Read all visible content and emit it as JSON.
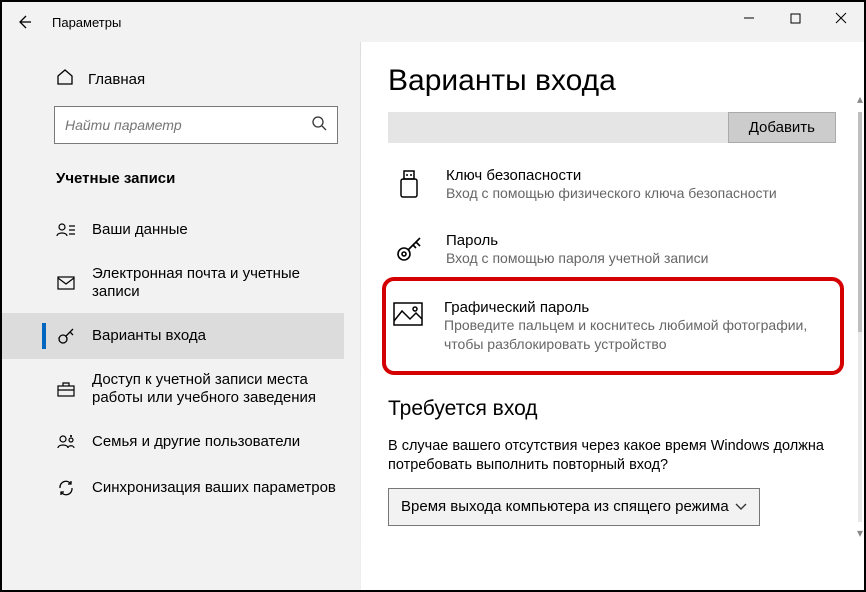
{
  "window": {
    "title": "Параметры"
  },
  "sidebar": {
    "home_label": "Главная",
    "search_placeholder": "Найти параметр",
    "section_title": "Учетные записи",
    "items": [
      {
        "label": "Ваши данные"
      },
      {
        "label": "Электронная почта и учетные записи"
      },
      {
        "label": "Варианты входа"
      },
      {
        "label": "Доступ к учетной записи места работы или учебного заведения"
      },
      {
        "label": "Семья и другие пользователи"
      },
      {
        "label": "Синхронизация ваших параметров"
      }
    ]
  },
  "content": {
    "heading": "Варианты входа",
    "add_button": "Добавить",
    "options": [
      {
        "title": "Ключ безопасности",
        "desc": "Вход с помощью физического ключа безопасности"
      },
      {
        "title": "Пароль",
        "desc": "Вход с помощью пароля учетной записи"
      },
      {
        "title": "Графический пароль",
        "desc": "Проведите пальцем и коснитесь любимой фотографии, чтобы разблокировать устройство"
      }
    ],
    "require_heading": "Требуется вход",
    "require_desc": "В случае вашего отсутствия через какое время Windows должна потребовать выполнить повторный вход?",
    "require_select": "Время выхода компьютера из спящего режима"
  }
}
